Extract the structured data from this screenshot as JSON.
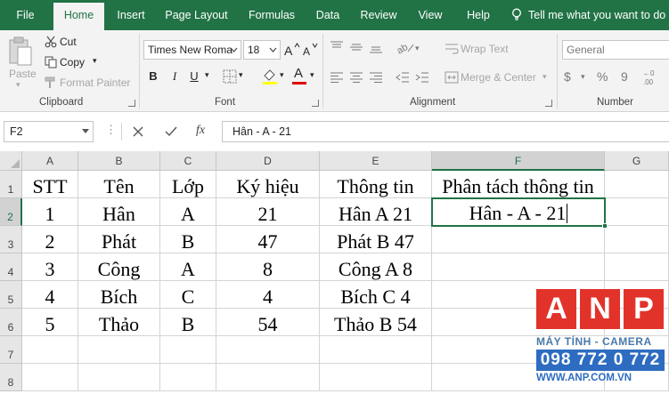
{
  "ribbon_tabs": [
    "File",
    "Home",
    "Insert",
    "Page Layout",
    "Formulas",
    "Data",
    "Review",
    "View",
    "Help"
  ],
  "active_tab": "Home",
  "tell_me": "Tell me what you want to do",
  "clipboard": {
    "paste": "Paste",
    "cut": "Cut",
    "copy": "Copy",
    "format_painter": "Format Painter",
    "label": "Clipboard"
  },
  "font": {
    "name": "Times New Roma",
    "size": "18",
    "bold": "B",
    "italic": "I",
    "underline": "U",
    "font_color_letter": "A",
    "label": "Font"
  },
  "alignment": {
    "wrap_text": "Wrap Text",
    "merge_center": "Merge & Center",
    "label": "Alignment"
  },
  "number": {
    "format": "General",
    "currency": "$",
    "percent": "%",
    "comma": "9",
    "label": "Number"
  },
  "formula_bar": {
    "name_box": "F2",
    "fx": "fx",
    "value": "Hân - A - 21"
  },
  "columns": [
    "A",
    "B",
    "C",
    "D",
    "E",
    "F",
    "G"
  ],
  "rows": [
    "1",
    "2",
    "3",
    "4",
    "5",
    "6",
    "7",
    "8"
  ],
  "table": {
    "headers": [
      "STT",
      "Tên",
      "Lớp",
      "Ký hiệu",
      "Thông tin",
      "Phân tách thông tin"
    ],
    "rows": [
      [
        "1",
        "Hân",
        "A",
        "21",
        "Hân A 21",
        "Hân - A - 21"
      ],
      [
        "2",
        "Phát",
        "B",
        "47",
        "Phát B 47",
        ""
      ],
      [
        "3",
        "Công",
        "A",
        "8",
        "Công A 8",
        ""
      ],
      [
        "4",
        "Bích",
        "C",
        "4",
        "Bích C 4",
        ""
      ],
      [
        "5",
        "Thảo",
        "B",
        "54",
        "Thảo B 54",
        ""
      ]
    ]
  },
  "active_cell": "F2",
  "colors": {
    "excel_green": "#217346",
    "logo_red": "#e1332a",
    "logo_blue": "#2d6cc0"
  },
  "watermark": {
    "letters": [
      "A",
      "N",
      "P"
    ],
    "tagline": "MÁY TÍNH - CAMERA",
    "phone": "098 772 0 772",
    "website": "WWW.ANP.COM.VN"
  }
}
